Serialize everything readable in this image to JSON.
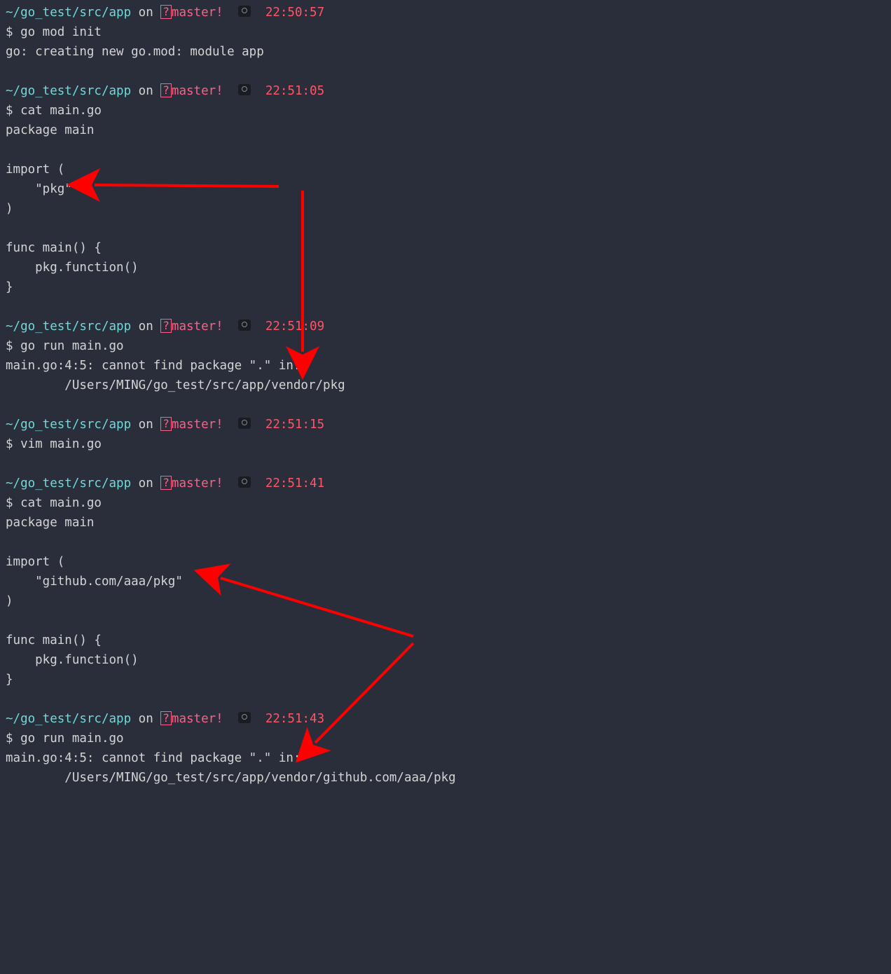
{
  "blocks": [
    {
      "path": "~/go_test/src/app",
      "on": " on ",
      "branch_mark": "?",
      "branch": "master",
      "bang": "!",
      "time": "22:50:57",
      "cmd": "$ go mod init",
      "out": [
        "go: creating new go.mod: module app",
        ""
      ]
    },
    {
      "path": "~/go_test/src/app",
      "on": " on ",
      "branch_mark": "?",
      "branch": "master",
      "bang": "!",
      "time": "22:51:05",
      "cmd": "$ cat main.go",
      "out": [
        "package main",
        "",
        "import (",
        "    \"pkg\"",
        ")",
        "",
        "func main() {",
        "    pkg.function()",
        "}",
        ""
      ]
    },
    {
      "path": "~/go_test/src/app",
      "on": " on ",
      "branch_mark": "?",
      "branch": "master",
      "bang": "!",
      "time": "22:51:09",
      "cmd": "$ go run main.go",
      "out": [
        "main.go:4:5: cannot find package \".\" in:",
        "        /Users/MING/go_test/src/app/vendor/pkg",
        ""
      ]
    },
    {
      "path": "~/go_test/src/app",
      "on": " on ",
      "branch_mark": "?",
      "branch": "master",
      "bang": "!",
      "time": "22:51:15",
      "cmd": "$ vim main.go",
      "out": [
        ""
      ]
    },
    {
      "path": "~/go_test/src/app",
      "on": " on ",
      "branch_mark": "?",
      "branch": "master",
      "bang": "!",
      "time": "22:51:41",
      "cmd": "$ cat main.go",
      "out": [
        "package main",
        "",
        "import (",
        "    \"github.com/aaa/pkg\"",
        ")",
        "",
        "func main() {",
        "    pkg.function()",
        "}",
        ""
      ]
    },
    {
      "path": "~/go_test/src/app",
      "on": " on ",
      "branch_mark": "?",
      "branch": "master",
      "bang": "!",
      "time": "22:51:43",
      "cmd": "$ go run main.go",
      "out": [
        "main.go:4:5: cannot find package \".\" in:",
        "        /Users/MING/go_test/src/app/vendor/github.com/aaa/pkg"
      ]
    }
  ],
  "annotations": {
    "arrow_color": "#ff0000"
  }
}
